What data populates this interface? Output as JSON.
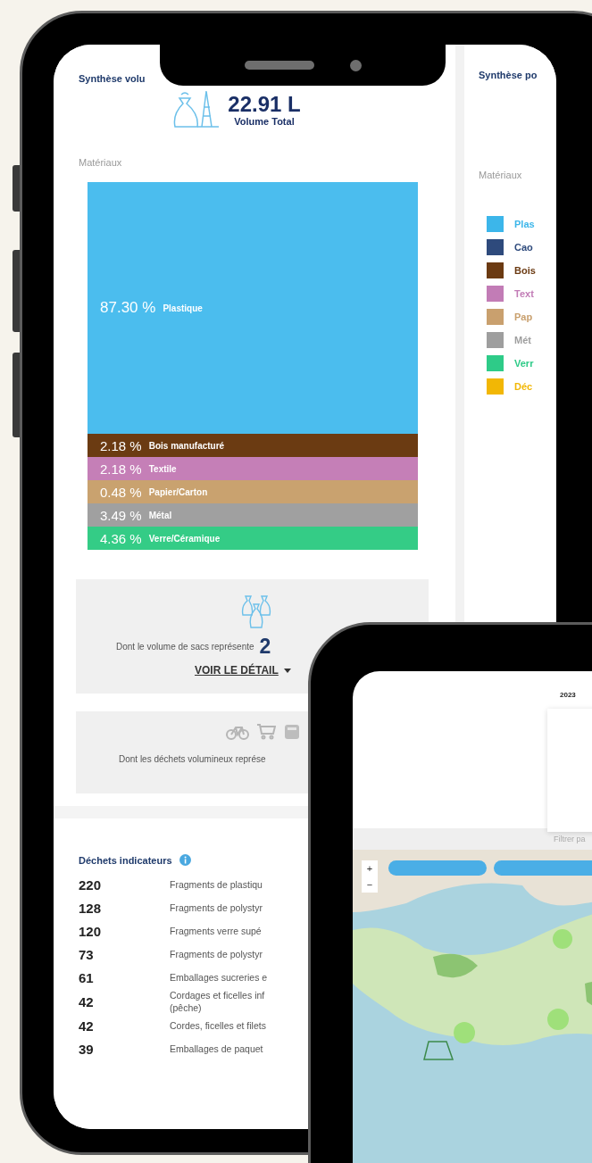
{
  "left_panel": {
    "title": "Synthèse volu",
    "total": {
      "value": "22.91 L",
      "label": "Volume Total"
    },
    "section_label": "Matériaux",
    "materials": [
      {
        "percent": "87.30 %",
        "label": "Plastique",
        "color": "#4bbdee"
      },
      {
        "percent": "2.18 %",
        "label": "Bois manufacturé",
        "color": "#6b3b12"
      },
      {
        "percent": "2.18 %",
        "label": "Textile",
        "color": "#c57fb7"
      },
      {
        "percent": "0.48 %",
        "label": "Papier/Carton",
        "color": "#c9a26f"
      },
      {
        "percent": "3.49 %",
        "label": "Métal",
        "color": "#a0a0a0"
      },
      {
        "percent": "4.36 %",
        "label": "Verre/Céramique",
        "color": "#34cc86"
      }
    ],
    "bags_card": {
      "text": "Dont le volume de sacs représente",
      "value": "2",
      "link": "VOIR LE DÉTAIL"
    },
    "bulky_card": {
      "text": "Dont les déchets volumineux représe"
    },
    "indicators": {
      "title": "Déchets indicateurs",
      "rows": [
        {
          "count": "220",
          "label": "Fragments de plastiqu"
        },
        {
          "count": "128",
          "label": "Fragments de polystyr"
        },
        {
          "count": "120",
          "label": "Fragments verre supé"
        },
        {
          "count": "73",
          "label": "Fragments de polystyr"
        },
        {
          "count": "61",
          "label": "Emballages sucreries e"
        },
        {
          "count": "42",
          "label": "Cordages et ficelles inf\n(pêche)"
        },
        {
          "count": "42",
          "label": "Cordes, ficelles et filets"
        },
        {
          "count": "39",
          "label": "Emballages de paquet"
        }
      ]
    }
  },
  "right_panel": {
    "title": "Synthèse po",
    "section_label": "Matériaux",
    "legend": [
      {
        "label": "Plas",
        "color": "#3cb6ea"
      },
      {
        "label": "Cao",
        "color": "#2e4a7c"
      },
      {
        "label": "Bois",
        "color": "#6b3a12"
      },
      {
        "label": "Text",
        "color": "#c27cb6"
      },
      {
        "label": "Pap",
        "color": "#c9a06e"
      },
      {
        "label": "Mét",
        "color": "#9e9e9e"
      },
      {
        "label": "Verr",
        "color": "#2ecb88"
      },
      {
        "label": "Déc",
        "color": "#f2b705"
      }
    ]
  },
  "second_phone": {
    "year_tab": "2023",
    "filter_label": "Filtrer pa",
    "map": {
      "zoom_in": "+",
      "zoom_out": "−"
    }
  }
}
